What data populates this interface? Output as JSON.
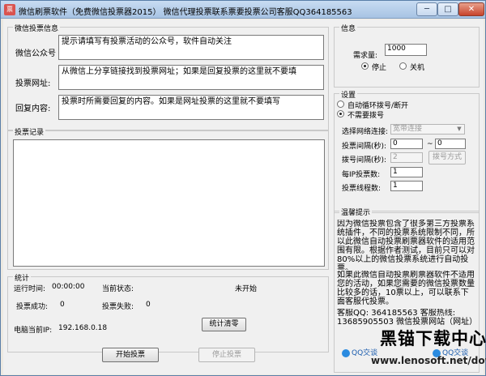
{
  "window": {
    "title": "微信刷票软件（免费微信投票器2015）   微信代理投票联系票要投票公司客服QQ364185563",
    "minimize": "─",
    "maximize": "□",
    "close": "✕"
  },
  "vote_info": {
    "legend": "微信投票信息",
    "account_label": "微信公众号",
    "account_value": "提示请填写有投票活动的公众号，软件自动关注",
    "url_label": "投票网址:",
    "url_value": "从微信上分享链接找到投票网址；如果是回复投票的这里就不要填",
    "reply_label": "回复内容:",
    "reply_value": "投票时所需要回复的内容。如果是网址投票的这里就不要填写"
  },
  "info": {
    "legend": "信息",
    "demand_label": "需求量:",
    "demand_value": "1000",
    "stop_label": "停止",
    "shutdown_label": "关机"
  },
  "settings": {
    "legend": "设置",
    "auto_dial_label": "自动循环拨号/断开",
    "no_dial_label": "不需要拨号",
    "network_label": "选择网络连接:",
    "network_value": "宽带连接",
    "vote_interval_label": "投票间隔(秒):",
    "vote_interval_from": "0",
    "vote_interval_sep": "~",
    "vote_interval_to": "0",
    "dial_interval_label": "拨号间隔(秒):",
    "dial_interval_value": "2",
    "dial_mode_button": "拨号方式",
    "ip_votes_label": "每IP投票数:",
    "ip_votes_value": "1",
    "threads_label": "投票线程数:",
    "threads_value": "1"
  },
  "log": {
    "legend": "投票记录"
  },
  "tips": {
    "legend": "温馨提示",
    "text1": "因为微信投票包含了很多第三方投票系统插件，不同的投票系统限制不同，所以此微信自动投票刷票器软件的适用范围有限。根据作者测试，目前只可以对80%以上的微信投票系统进行自动投票。",
    "text2": "如果此微信自动投票刷票器软件不适用您的活动，如果您需要的微信投票数量比较多的话，10票以上，可以联系下面客服代投票。",
    "support_qq": "客服QQ: 364185563   客服热线: 13685905503   微信投票网站（网址）",
    "qq_chat1": "QQ交谈",
    "qq_chat2": "QQ交谈"
  },
  "stats": {
    "legend": "统计",
    "runtime_label": "运行时间:",
    "runtime_value": "00:00:00",
    "state_label": "当前状态:",
    "state_value": "未开始",
    "success_label": "投票成功:",
    "success_value": "0",
    "fail_label": "投票失败:",
    "fail_value": "0",
    "ip_label": "电脑当前IP:",
    "ip_value": "192.168.0.18",
    "clear_button": "统计清零"
  },
  "actions": {
    "start_button": "开始投票",
    "stop_button": "停止投票"
  },
  "watermark": {
    "brand": "黑锚下载中心",
    "url": "www.lenosoft.net/down/"
  },
  "colors": {
    "watermark_brand": "#000000",
    "window_frame": "#5a7ea8",
    "close_button": "#c7432b"
  }
}
